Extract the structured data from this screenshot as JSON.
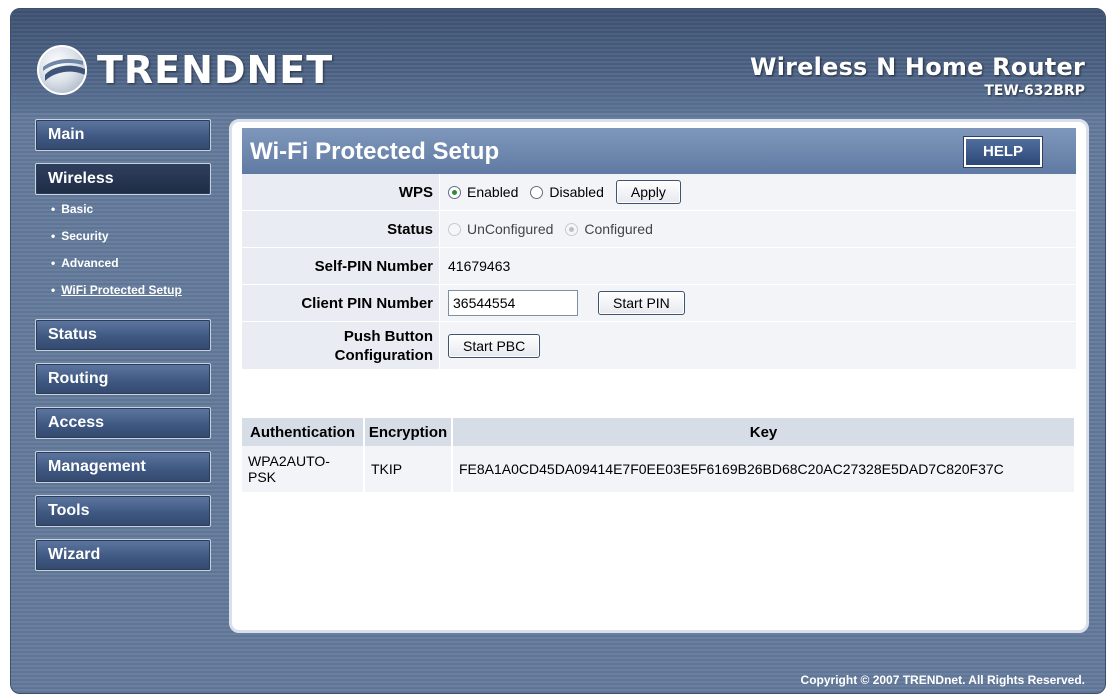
{
  "header": {
    "logo_text": "TRENDNET",
    "product_title": "Wireless N Home Router",
    "product_model": "TEW-632BRP"
  },
  "sidebar": {
    "items": [
      {
        "label": "Main"
      },
      {
        "label": "Wireless"
      },
      {
        "label": "Status"
      },
      {
        "label": "Routing"
      },
      {
        "label": "Access"
      },
      {
        "label": "Management"
      },
      {
        "label": "Tools"
      },
      {
        "label": "Wizard"
      }
    ],
    "wireless_sub": [
      {
        "label": "Basic"
      },
      {
        "label": "Security"
      },
      {
        "label": "Advanced"
      },
      {
        "label": "WiFi Protected Setup"
      }
    ],
    "bullet": "•"
  },
  "panel": {
    "title": "Wi-Fi Protected Setup",
    "help_label": "HELP"
  },
  "form": {
    "wps": {
      "label": "WPS",
      "enabled_label": "Enabled",
      "disabled_label": "Disabled",
      "selected": "Enabled",
      "apply_label": "Apply"
    },
    "status": {
      "label": "Status",
      "unconfigured_label": "UnConfigured",
      "configured_label": "Configured",
      "selected": "Configured"
    },
    "self_pin": {
      "label": "Self-PIN Number",
      "value": "41679463"
    },
    "client_pin": {
      "label": "Client PIN Number",
      "value": "36544554",
      "button_label": "Start PIN"
    },
    "pbc": {
      "label_line1": "Push Button",
      "label_line2": "Configuration",
      "button_label": "Start PBC"
    }
  },
  "security_table": {
    "headers": [
      "Authentication",
      "Encryption",
      "Key"
    ],
    "rows": [
      {
        "authentication": "WPA2AUTO-PSK",
        "encryption": "TKIP",
        "key": "FE8A1A0CD45DA09414E7F0EE03E5F6169B26BD68C20AC27328E5DAD7C820F37C"
      }
    ]
  },
  "footer": {
    "copyright": "Copyright © 2007 TRENDnet. All Rights Reserved."
  }
}
